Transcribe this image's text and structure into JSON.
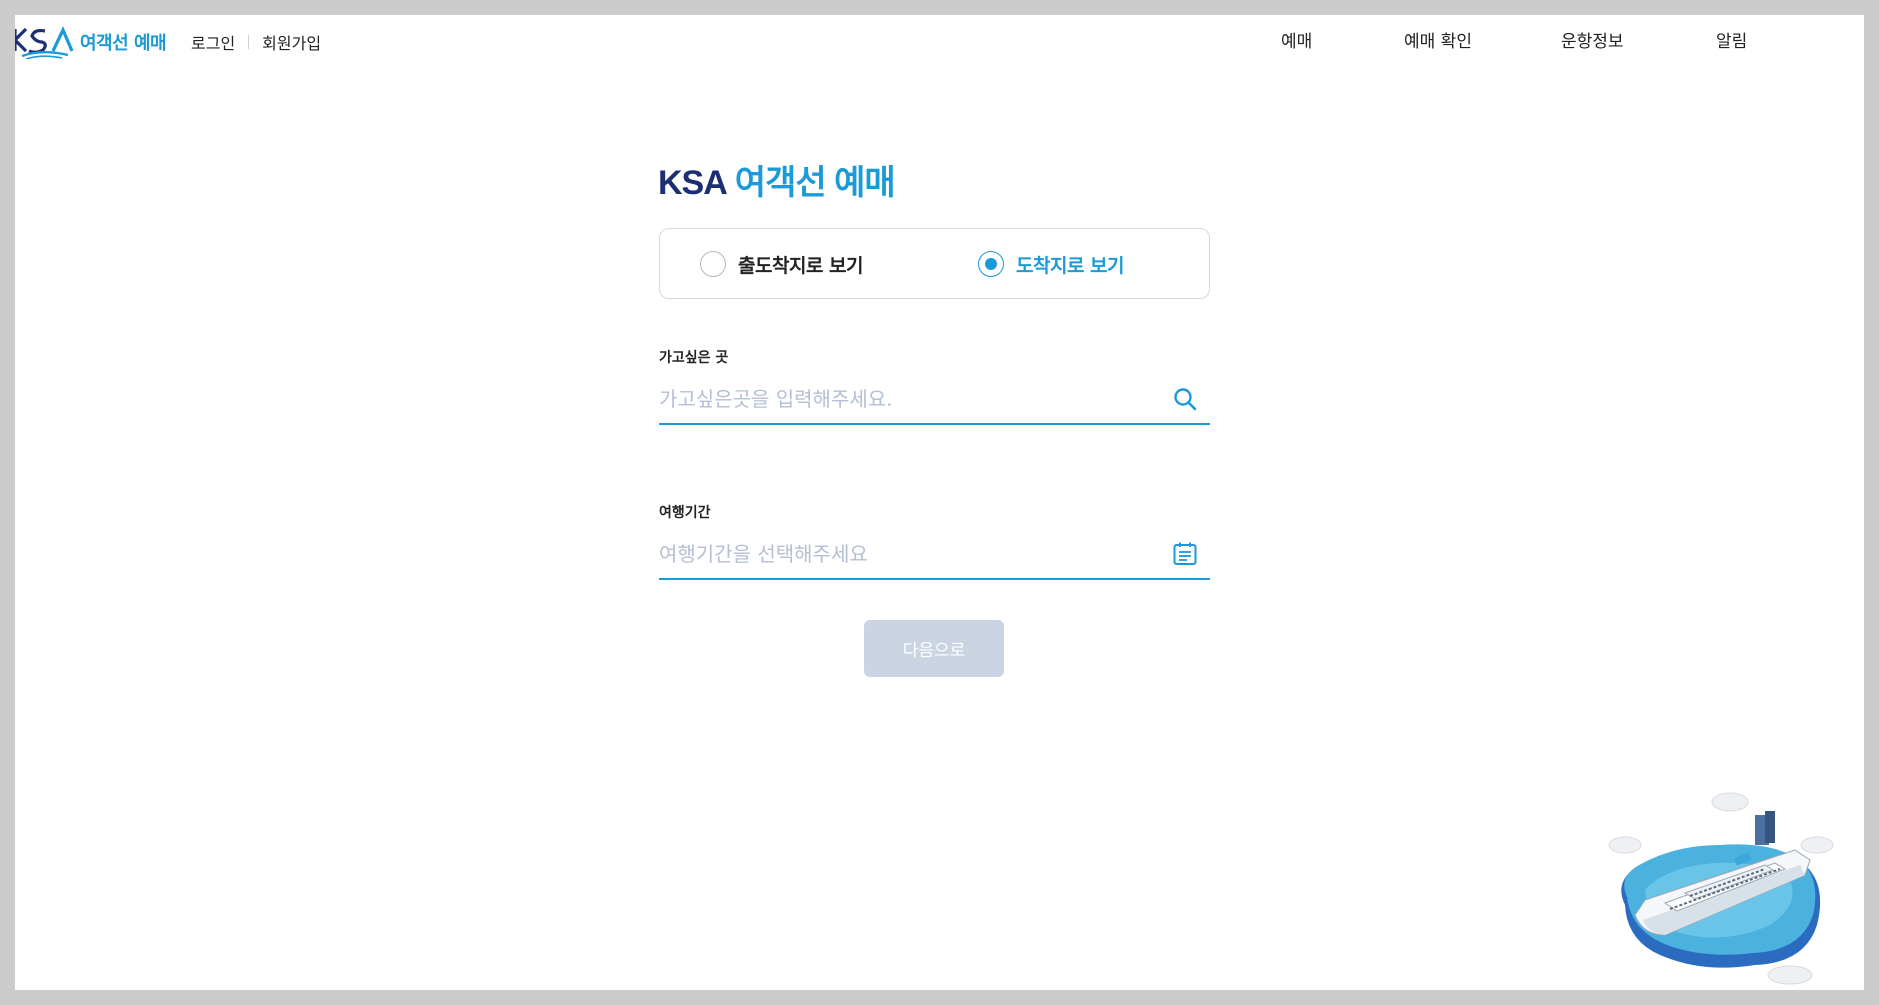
{
  "header": {
    "logo_text": "여객선 예매",
    "login": "로그인",
    "signup": "회원가입",
    "nav": [
      "예매",
      "예매 확인",
      "운항정보",
      "알림"
    ]
  },
  "main": {
    "title_part1": "KSA",
    "title_part2": "여객선 예매",
    "view_options": [
      {
        "label": "출도착지로 보기",
        "checked": false
      },
      {
        "label": "도착지로 보기",
        "checked": true
      }
    ],
    "destination": {
      "label": "가고싶은 곳",
      "placeholder": "가고싶은곳을 입력해주세요.",
      "value": ""
    },
    "period": {
      "label": "여행기간",
      "placeholder": "여행기간을 선택해주세요",
      "value": ""
    },
    "next_button": "다음으로"
  },
  "colors": {
    "brand_blue": "#1a9ad6",
    "brand_navy": "#1b2f72",
    "button_disabled": "#cbd4e3",
    "placeholder": "#b4bfd4"
  },
  "icons": {
    "logo": "ksa-logo-icon",
    "destination": "search-icon",
    "period": "calendar-icon",
    "illustration": "ship-illustration-icon"
  }
}
